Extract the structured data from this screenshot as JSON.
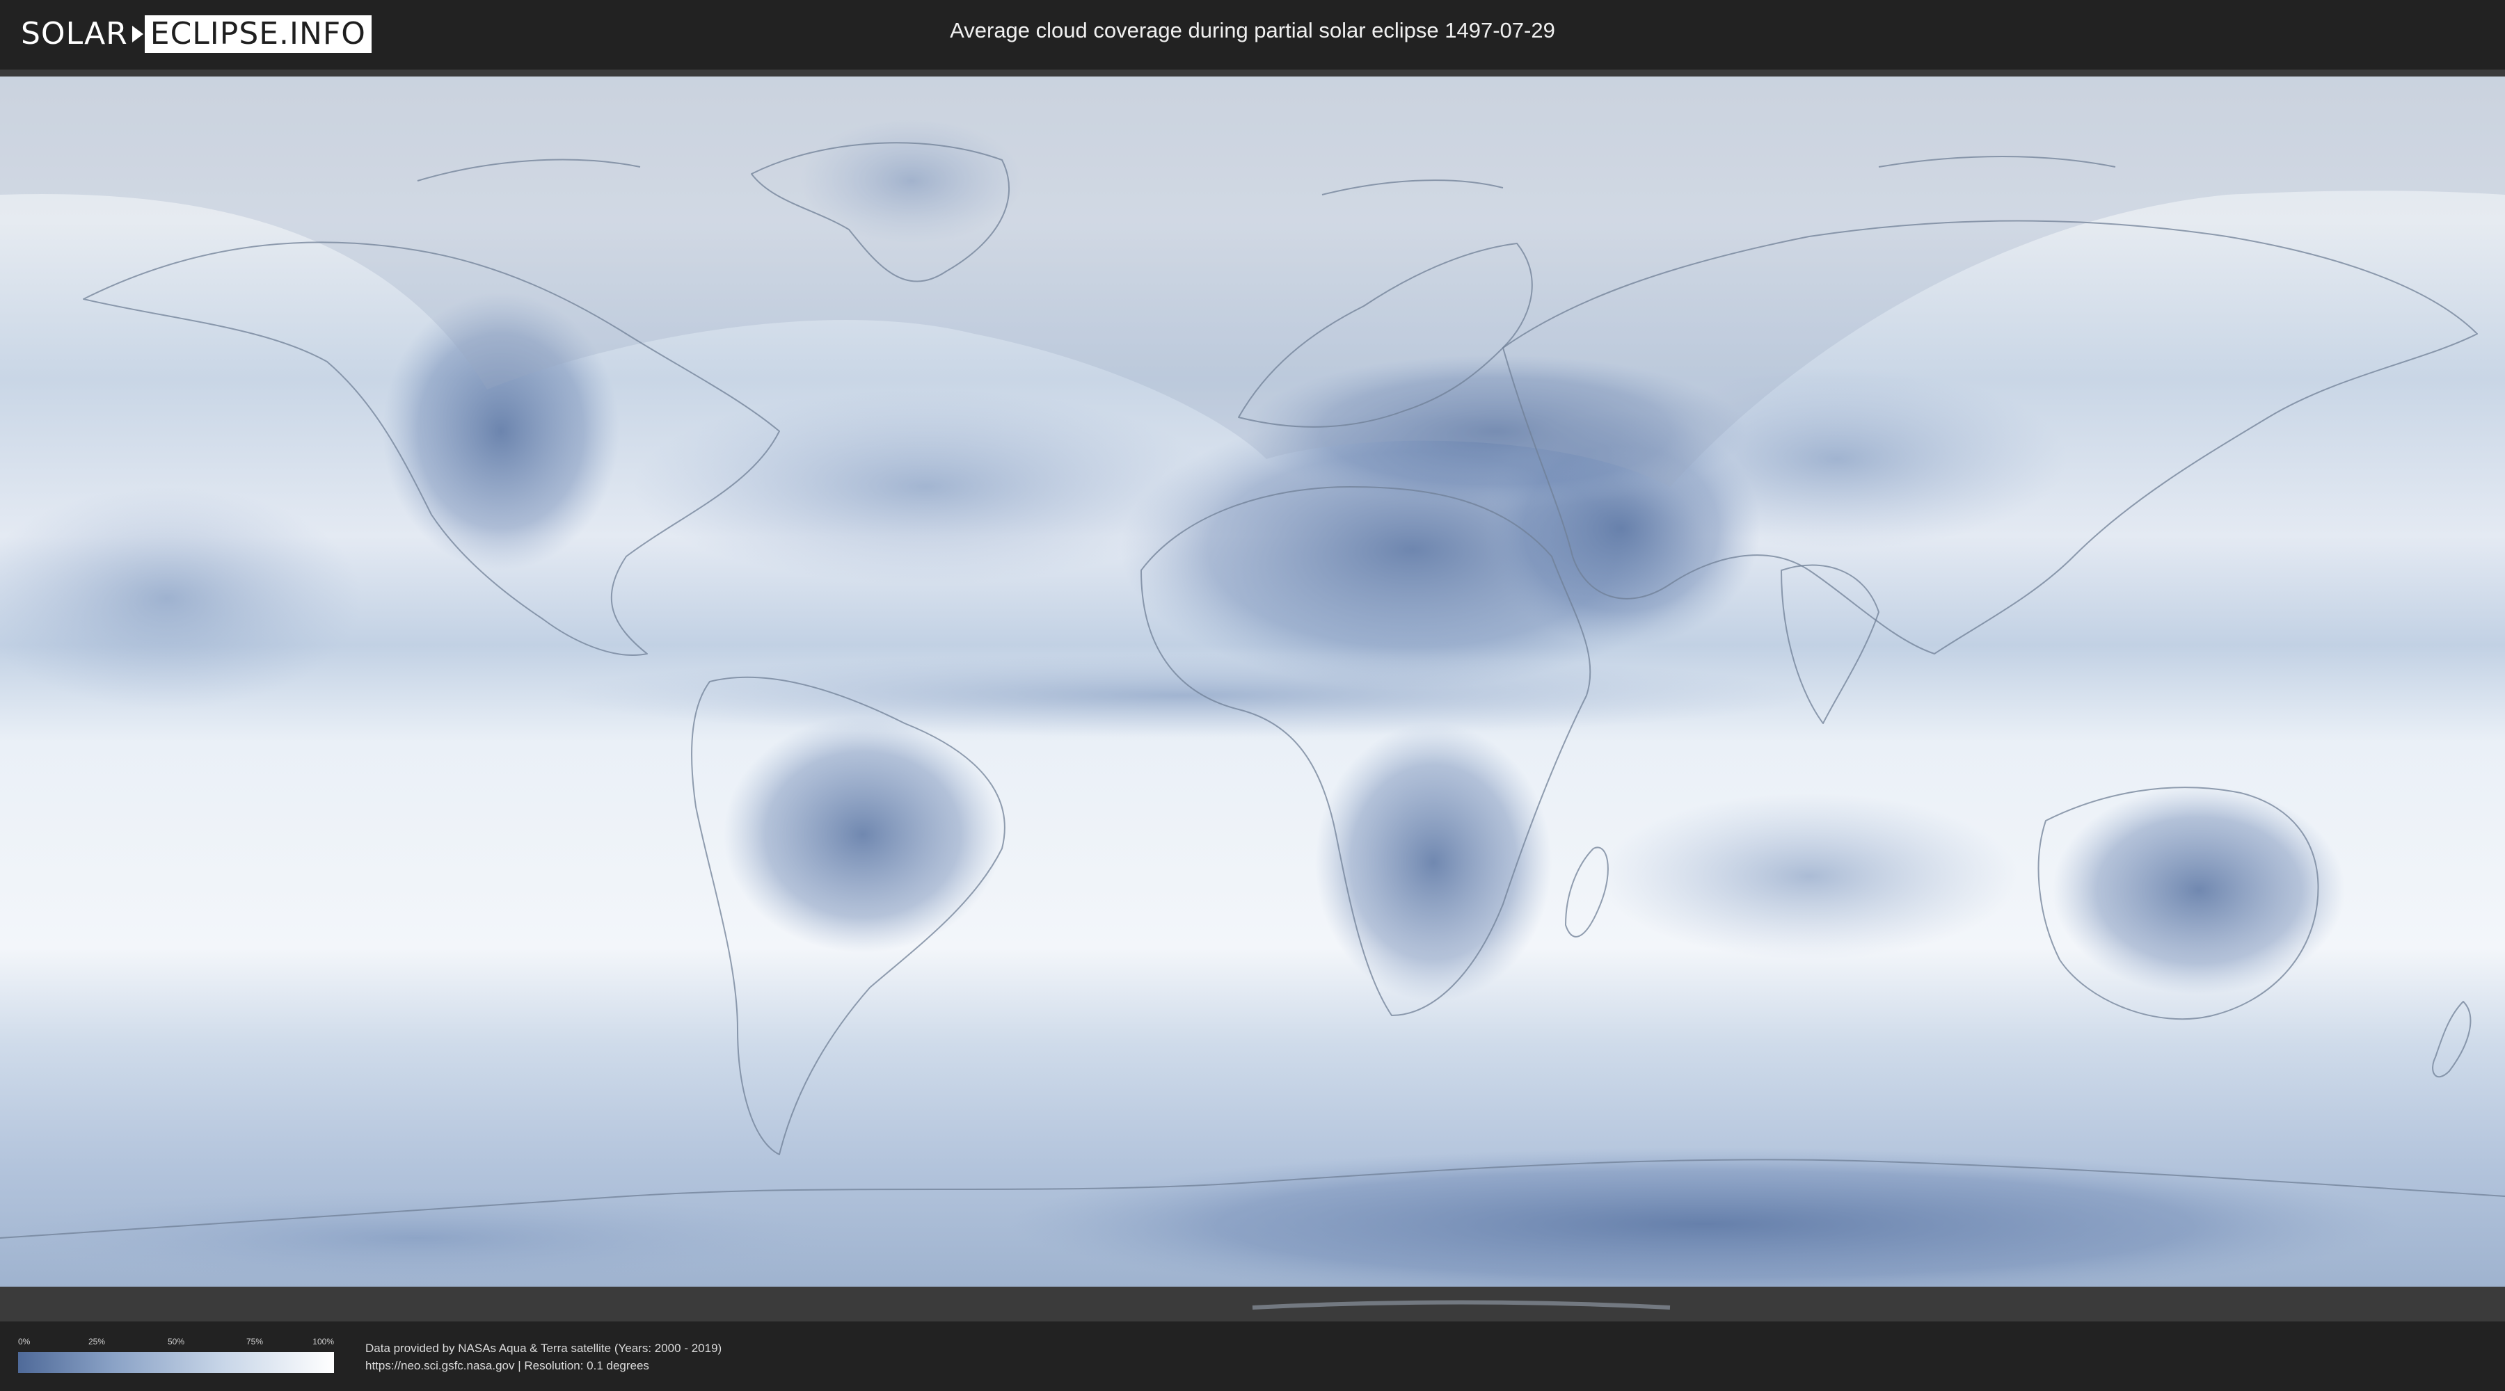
{
  "header": {
    "logo_left": "SOLAR",
    "logo_right": "ECLIPSE.INFO",
    "title": "Average cloud coverage during partial solar eclipse 1497-07-29"
  },
  "map": {
    "colors": {
      "ocean_cloud": "#eef2f8",
      "clear_sky": "#5a75a3",
      "land_outline": "#6f7f96",
      "frame": "#3b3b3b"
    }
  },
  "legend": {
    "ticks": [
      "0%",
      "25%",
      "50%",
      "75%",
      "100%"
    ],
    "tick_values": [
      0,
      25,
      50,
      75,
      100
    ],
    "gradient_colors": [
      "#4f6a99",
      "#8aa2c6",
      "#c8d6e8",
      "#ffffff"
    ]
  },
  "footer": {
    "credit_line1": "Data provided by NASAs Aqua & Terra satellite (Years: 2000 - 2019)",
    "credit_line2": "https://neo.sci.gsfc.nasa.gov | Resolution: 0.1 degrees"
  }
}
